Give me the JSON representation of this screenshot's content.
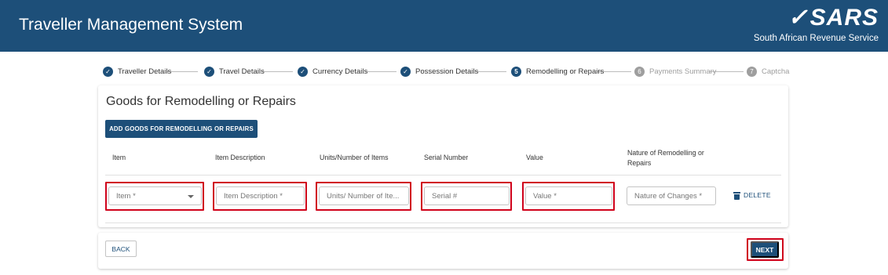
{
  "header": {
    "title": "Traveller Management System",
    "logo_text": "SARS",
    "logo_subtitle": "South African Revenue Service"
  },
  "stepper": {
    "steps": [
      {
        "label": "Traveller Details",
        "state": "done",
        "marker": "✓"
      },
      {
        "label": "Travel Details",
        "state": "done",
        "marker": "✓"
      },
      {
        "label": "Currency Details",
        "state": "done",
        "marker": "✓"
      },
      {
        "label": "Possession Details",
        "state": "done",
        "marker": "✓"
      },
      {
        "label": "Remodelling or Repairs",
        "state": "active",
        "marker": "5"
      },
      {
        "label": "Payments Summary",
        "state": "pending",
        "marker": "6"
      },
      {
        "label": "Captcha",
        "state": "pending",
        "marker": "7"
      }
    ]
  },
  "goods": {
    "title": "Goods for Remodelling or Repairs",
    "add_button": "ADD GOODS FOR REMODELLING OR REPAIRS",
    "columns": [
      "Item",
      "Item Description",
      "Units/Number of Items",
      "Serial Number",
      "Value",
      "Nature of Remodelling or Repairs"
    ],
    "row": {
      "item_placeholder": "Item *",
      "description_placeholder": "Item Description *",
      "units_placeholder": "Units/ Number of Ite...",
      "serial_placeholder": "Serial #",
      "value_placeholder": "Value *",
      "nature_placeholder": "Nature of Changes *",
      "delete_label": "DELETE"
    }
  },
  "nav": {
    "back_label": "BACK",
    "next_label": "NEXT"
  },
  "colors": {
    "brand": "#1d4f79",
    "highlight": "#d0021b"
  }
}
